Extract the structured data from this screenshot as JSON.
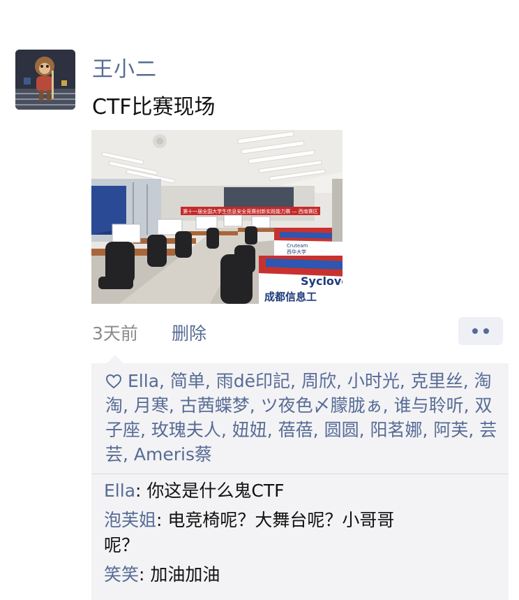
{
  "post": {
    "author": "王小二",
    "text": "CTF比赛现场",
    "time": "3天前",
    "delete_label": "删除"
  },
  "photo": {
    "banner_text": "第十一届全国大学生信息安全竞赛创新实践能力赛 — 西南赛区",
    "sign_1_line_1": "Syclover",
    "sign_1_line_2": "成都信息工",
    "sign_2_line_1": "Cruteam",
    "sign_2_line_2": "西华大学"
  },
  "likes": {
    "names": "Ella, 简单, 雨dē印記, 周欣, 小时光, 克里丝, 淘淘, 月寒, 古茜蝶梦, ツ夜色〆朦胧ぁ, 谁与聆听, 双子座, 玫瑰夫人, 妞妞, 蓓蓓, 圆圆, 阳茗娜, 阿芙, 芸芸, Ameris蔡"
  },
  "comments": [
    {
      "who": "Ella",
      "text": ": 你这是什么鬼CTF"
    },
    {
      "who": "泡芙姐",
      "text": ": 电竞椅呢？大舞台呢？小哥哥呢？"
    },
    {
      "who": "笑笑",
      "text": ": 加油加油"
    }
  ],
  "colors": {
    "link": "#576b95",
    "panel_bg": "#f3f3f5",
    "meta_gray": "#8a8a8a"
  },
  "icons": {
    "like": "heart-outline-icon",
    "more": "more-dots-icon"
  }
}
